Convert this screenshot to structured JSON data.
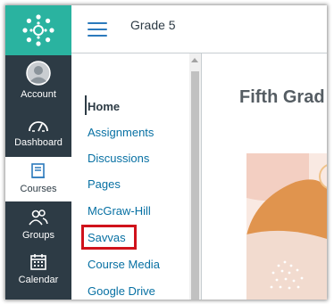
{
  "global_nav": {
    "items": [
      {
        "label": "Account",
        "icon": "account-avatar-icon"
      },
      {
        "label": "Dashboard",
        "icon": "dashboard-icon"
      },
      {
        "label": "Courses",
        "icon": "courses-icon",
        "active": true
      },
      {
        "label": "Groups",
        "icon": "groups-icon"
      },
      {
        "label": "Calendar",
        "icon": "calendar-icon"
      }
    ]
  },
  "header": {
    "breadcrumb": "Grade 5"
  },
  "course_nav": {
    "items": [
      {
        "label": "Home"
      },
      {
        "label": "Assignments"
      },
      {
        "label": "Discussions"
      },
      {
        "label": "Pages"
      },
      {
        "label": "McGraw-Hill"
      },
      {
        "label": "Savvas"
      },
      {
        "label": "Course Media"
      },
      {
        "label": "Google Drive"
      }
    ]
  },
  "main": {
    "title": "Fifth Grad"
  },
  "colors": {
    "nav_bg": "#2d3b45",
    "logo_bg": "#2ab3a0",
    "link": "#0770a3",
    "highlight": "#d0121b",
    "banner_bg": "#f9e9e2",
    "banner_shape": "#e0944e"
  }
}
